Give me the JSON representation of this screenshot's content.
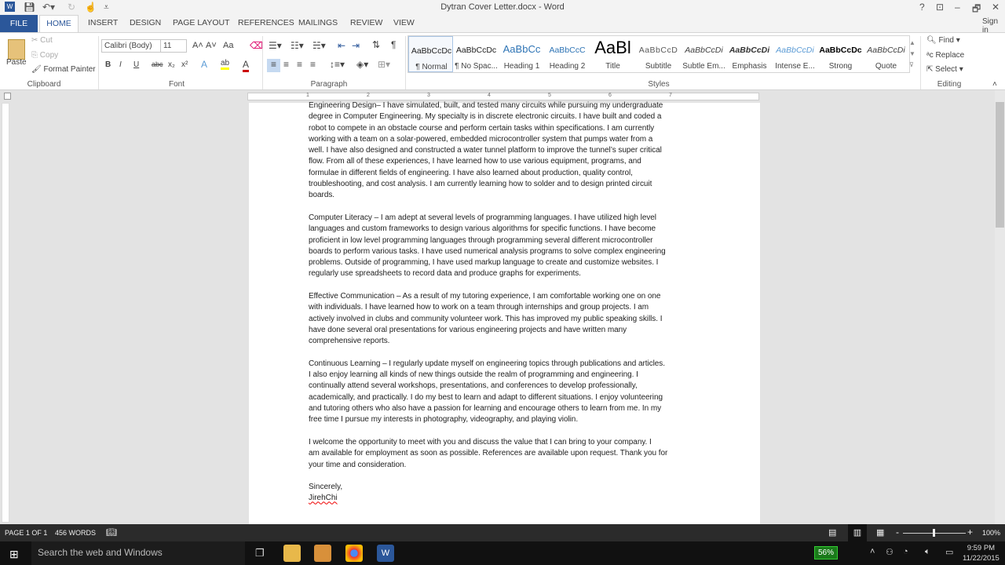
{
  "window": {
    "title": "Dytran Cover Letter.docx - Word",
    "help": "?",
    "restore_ribbon": "⊡",
    "minimize": "–",
    "maximize": "🗗",
    "close": "✕",
    "sign_in": "Sign in"
  },
  "quick_access": {
    "icons": [
      "word-logo-icon",
      "save-icon",
      "undo-icon",
      "redo-icon",
      "touch-mode-icon",
      "customize-icon"
    ]
  },
  "tabs": [
    {
      "label": "FILE"
    },
    {
      "label": "HOME",
      "active": true
    },
    {
      "label": "INSERT"
    },
    {
      "label": "DESIGN"
    },
    {
      "label": "PAGE LAYOUT"
    },
    {
      "label": "REFERENCES"
    },
    {
      "label": "MAILINGS"
    },
    {
      "label": "REVIEW"
    },
    {
      "label": "VIEW"
    }
  ],
  "clipboard": {
    "paste": "Paste",
    "cut": "Cut",
    "copy": "Copy",
    "format_painter": "Format Painter",
    "group": "Clipboard"
  },
  "font": {
    "name": "Calibri (Body)",
    "size": "11",
    "group": "Font",
    "bold": "B",
    "italic": "I",
    "underline": "U",
    "strike": "abc",
    "sub": "x₂",
    "sup": "x²",
    "change_case": "Aa",
    "grow": "A˄",
    "shrink": "A˅"
  },
  "paragraph": {
    "group": "Paragraph"
  },
  "styles": {
    "group": "Styles",
    "items": [
      {
        "preview": "AaBbCcDc",
        "name": "¶ Normal",
        "selected": true
      },
      {
        "preview": "AaBbCcDc",
        "name": "¶ No Spac..."
      },
      {
        "preview": "AaBbCc",
        "name": "Heading 1"
      },
      {
        "preview": "AaBbCcC",
        "name": "Heading 2"
      },
      {
        "preview": "AaBl",
        "name": "Title"
      },
      {
        "preview": "AaBbCcD",
        "name": "Subtitle"
      },
      {
        "preview": "AaBbCcDi",
        "name": "Subtle Em..."
      },
      {
        "preview": "AaBbCcDi",
        "name": "Emphasis"
      },
      {
        "preview": "AaBbCcDi",
        "name": "Intense E..."
      },
      {
        "preview": "AaBbCcDc",
        "name": "Strong"
      },
      {
        "preview": "AaBbCcDi",
        "name": "Quote"
      }
    ]
  },
  "editing": {
    "group": "Editing",
    "find": "Find",
    "replace": "Replace",
    "select": "Select"
  },
  "document": {
    "paragraphs": [
      [
        "Engineering Design– I have simulated, built, and tested many circuits while pursuing my undergraduate",
        "degree in Computer Engineering. My specialty is in discrete electronic circuits. I have built and coded a",
        "robot to compete in an obstacle course and perform certain tasks within specifications. I am currently",
        "working with a team on a solar-powered, embedded microcontroller system that pumps water from a",
        "well. I have also designed and constructed a water tunnel platform to improve the tunnel’s super critical",
        "flow. From all of these experiences, I have learned how to use various equipment, programs, and",
        "formulae in different fields of engineering. I have also learned about production, quality control,",
        "troubleshooting, and cost analysis. I am currently learning how to solder and to design printed circuit",
        "boards."
      ],
      [
        "Computer Literacy – I am adept at several levels of programming languages. I have utilized high level",
        "languages and custom frameworks to design various algorithms for specific functions. I have become",
        "proficient in low level programming languages through programming several different microcontroller",
        "boards to perform various tasks. I have used numerical analysis programs to solve complex engineering",
        "problems. Outside of programming, I have used markup language to create and customize websites. I",
        "regularly use spreadsheets to record data and produce graphs for experiments."
      ],
      [
        "Effective Communication – As a result of my tutoring experience, I am comfortable working one on one",
        "with individuals. I have learned how to work on a team through internships and group projects. I am",
        "actively involved in clubs and community volunteer work. This has improved my public speaking skills. I",
        "have done several oral presentations for various engineering projects and have written many",
        "comprehensive reports."
      ],
      [
        "Continuous Learning – I regularly update myself on engineering topics through publications and articles.",
        "I also enjoy learning all kinds of new things outside the realm of programming and engineering. I",
        "continually attend several workshops, presentations, and conferences to develop professionally,",
        "academically, and practically. I do my best to learn and adapt to different situations. I enjoy volunteering",
        "and tutoring others who also have a passion for learning and encourage others to learn from me. In my",
        "free time I pursue my interests in photography, videography, and playing violin."
      ],
      [
        "I welcome the opportunity to meet with you and discuss the value that I can bring to your company. I",
        "am available for employment as soon as possible.  References are available upon request. Thank you for",
        "your time and consideration."
      ]
    ],
    "closing": "Sincerely,",
    "signature": "JirehChi"
  },
  "status": {
    "page": "PAGE 1 OF 1",
    "words": "456 WORDS",
    "zoom": "100%"
  },
  "taskbar": {
    "search_placeholder": "Search the web and Windows",
    "battery": "56%",
    "time": "9:59 PM",
    "date": "11/22/2015"
  },
  "colors": {
    "accent": "#2b579a",
    "status_bar": "#2b2b2b",
    "taskbar": "#111111"
  }
}
